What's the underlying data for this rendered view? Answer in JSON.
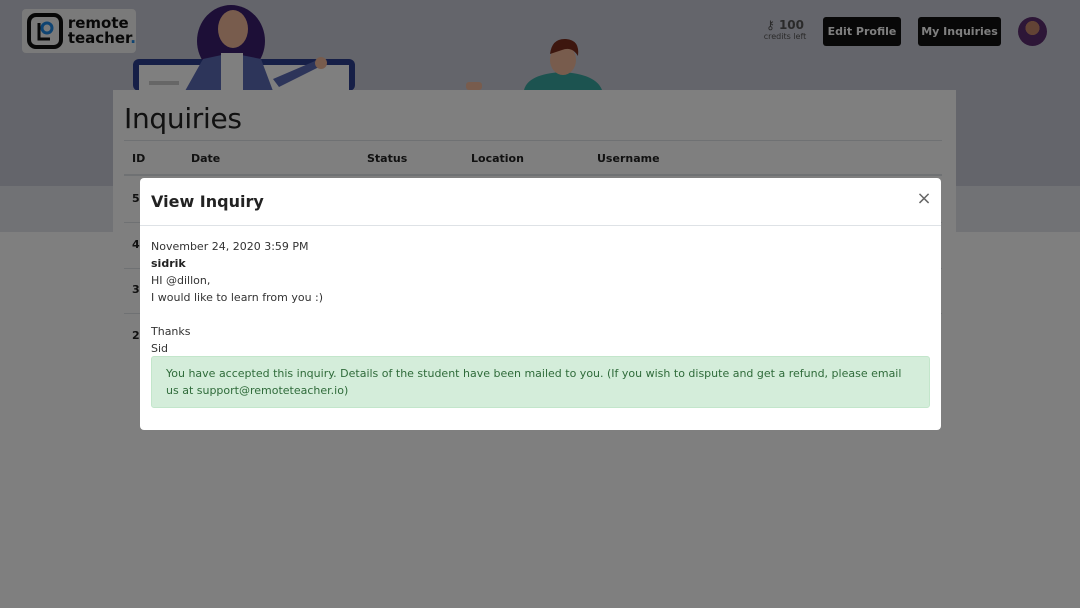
{
  "brand": {
    "line1": "remote",
    "line2": "teacher",
    "dot": "."
  },
  "header": {
    "credits_count": "100",
    "credits_label": "credits left",
    "edit_profile_label": "Edit Profile",
    "my_inquiries_label": "My Inquiries"
  },
  "inquiries": {
    "title": "Inquiries",
    "columns": [
      "ID",
      "Date",
      "Status",
      "Location",
      "Username"
    ],
    "row_ids": [
      "5",
      "4",
      "3",
      "2"
    ]
  },
  "modal": {
    "title": "View Inquiry",
    "close_label": "×",
    "date": "November 24, 2020 3:59 PM",
    "sender": "sidrik",
    "message_lines": [
      "HI @dillon,",
      "I would like to learn from you :)",
      "",
      "Thanks",
      "Sid"
    ],
    "alert_text": "You have accepted this inquiry. Details of the student have been mailed to you. (If you wish to dispute and get a refund, please email us at support@remoteteacher.io)"
  },
  "icons": {
    "logo": "remote-teacher-logo-icon",
    "credits": "key-icon",
    "close": "close-icon"
  },
  "colors": {
    "button_bg": "#111111",
    "alert_bg": "#d4edda",
    "alert_text": "#2f6b3a"
  }
}
